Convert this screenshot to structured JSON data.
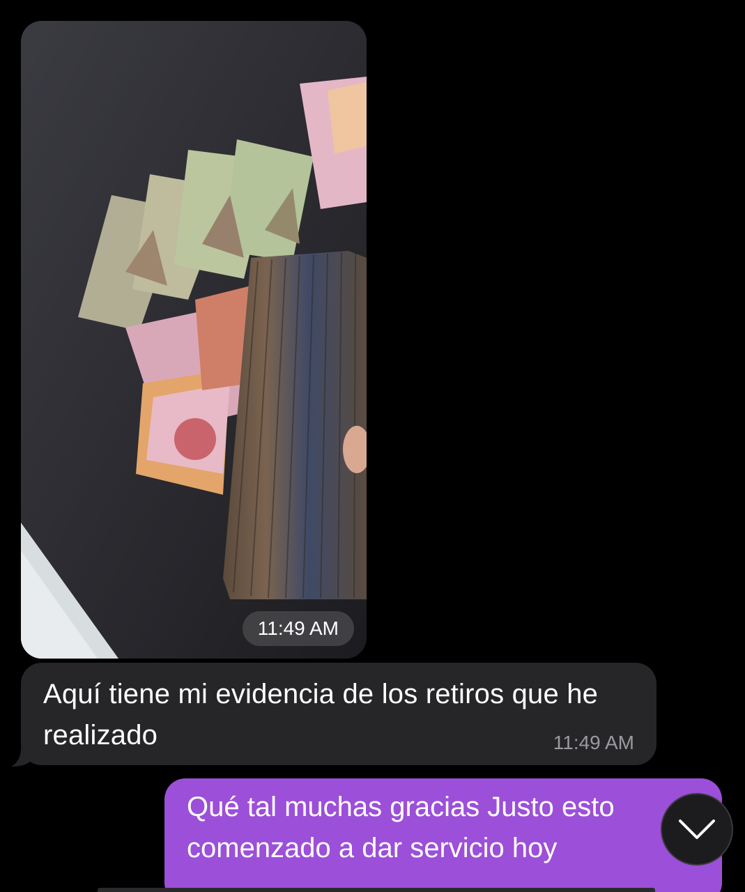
{
  "messages": [
    {
      "type": "photo",
      "direction": "incoming",
      "time": "11:49 AM"
    },
    {
      "type": "text",
      "direction": "incoming",
      "text": "Aquí tiene mi evidencia de los retiros que he realizado",
      "time": "11:49 AM"
    },
    {
      "type": "text",
      "direction": "outgoing",
      "text": "Qué tal muchas gracias Justo esto comenzado a dar servicio hoy"
    }
  ],
  "scroll_button": {
    "icon": "chevron-down-icon"
  },
  "colors": {
    "background": "#000000",
    "incoming_bubble": "#262628",
    "outgoing_bubble": "#9c4fd8",
    "time_text": "#9a9aa0"
  }
}
